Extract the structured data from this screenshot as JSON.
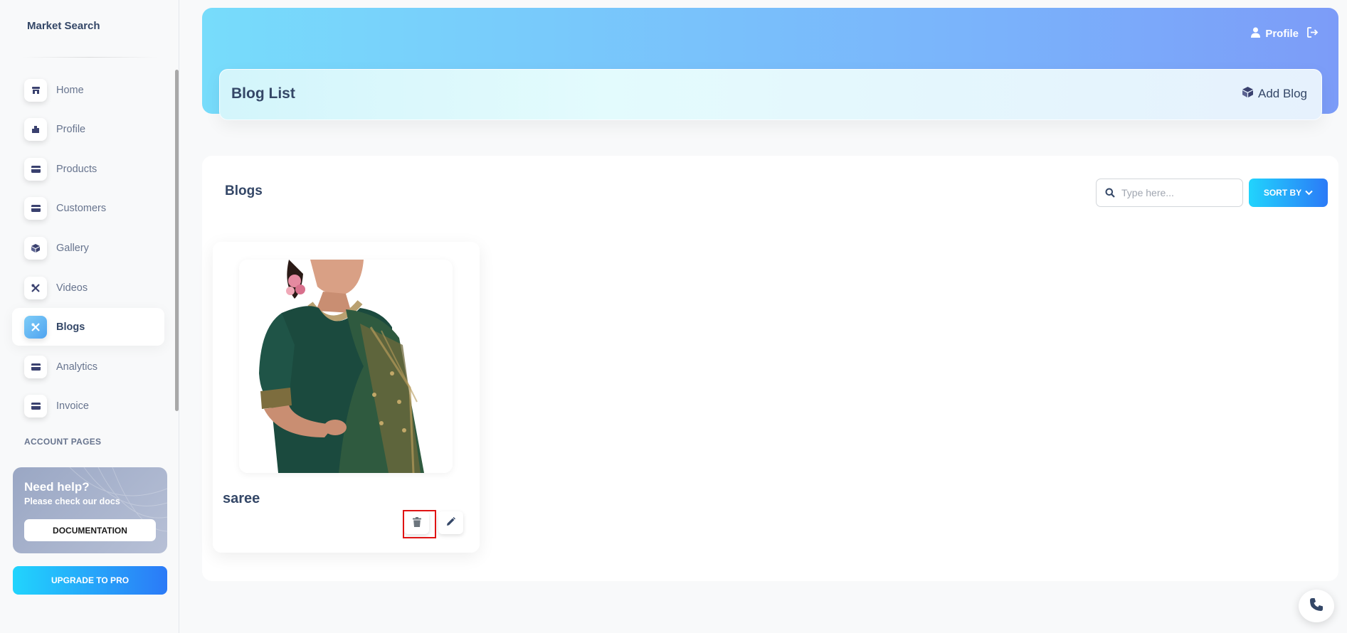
{
  "sidebar": {
    "brand": "Market Search",
    "items": [
      {
        "label": "Home",
        "icon": "store-icon",
        "active": false
      },
      {
        "label": "Profile",
        "icon": "building-icon",
        "active": false
      },
      {
        "label": "Products",
        "icon": "credit-card-icon",
        "active": false
      },
      {
        "label": "Customers",
        "icon": "credit-card-icon",
        "active": false
      },
      {
        "label": "Gallery",
        "icon": "box-icon",
        "active": false
      },
      {
        "label": "Videos",
        "icon": "tools-icon",
        "active": false
      },
      {
        "label": "Blogs",
        "icon": "tools-icon",
        "active": true
      },
      {
        "label": "Analytics",
        "icon": "credit-card-icon",
        "active": false
      },
      {
        "label": "Invoice",
        "icon": "credit-card-icon",
        "active": false
      }
    ],
    "section_title": "ACCOUNT PAGES",
    "help": {
      "title": "Need help?",
      "subtitle": "Please check our docs",
      "button": "DOCUMENTATION"
    },
    "upgrade_button": "UPGRADE TO PRO"
  },
  "header": {
    "profile_label": "Profile",
    "page_title": "Blog List",
    "add_button": "Add Blog"
  },
  "main": {
    "title": "Blogs",
    "search": {
      "placeholder": "Type here...",
      "value": ""
    },
    "sort_button": "SORT BY",
    "blogs": [
      {
        "title": "saree",
        "image": "saree-photo"
      }
    ]
  },
  "colors": {
    "accent_start": "#21d4fd",
    "accent_end": "#2b7af7",
    "text_primary": "#344767",
    "text_muted": "#67748e",
    "highlight": "#e01313"
  }
}
